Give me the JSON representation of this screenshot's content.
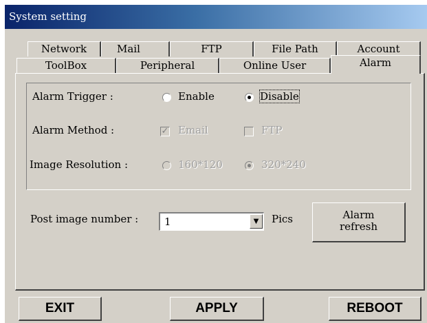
{
  "window": {
    "title": "System setting"
  },
  "tabs": {
    "row_back": [
      "Network",
      "Mail",
      "FTP",
      "File Path",
      "Account"
    ],
    "row_front": [
      "ToolBox",
      "Peripheral",
      "Online User",
      "Alarm"
    ],
    "active": "Alarm"
  },
  "alarm_trigger": {
    "label": "Alarm Trigger :",
    "options": [
      "Enable",
      "Disable"
    ],
    "selected": "Disable"
  },
  "alarm_method": {
    "label": "Alarm Method :",
    "email_label": "Email",
    "email_checked": true,
    "ftp_label": "FTP",
    "ftp_checked": false,
    "enabled": false
  },
  "image_resolution": {
    "label": "Image Resolution :",
    "options": [
      "160*120",
      "320*240"
    ],
    "selected": "320*240",
    "enabled": false
  },
  "post_image": {
    "label": "Post image number :",
    "value": "1",
    "unit": "Pics"
  },
  "alarm_refresh": {
    "line1": "Alarm",
    "line2": "refresh"
  },
  "footer": {
    "exit": "EXIT",
    "apply": "APPLY",
    "reboot": "REBOOT"
  }
}
